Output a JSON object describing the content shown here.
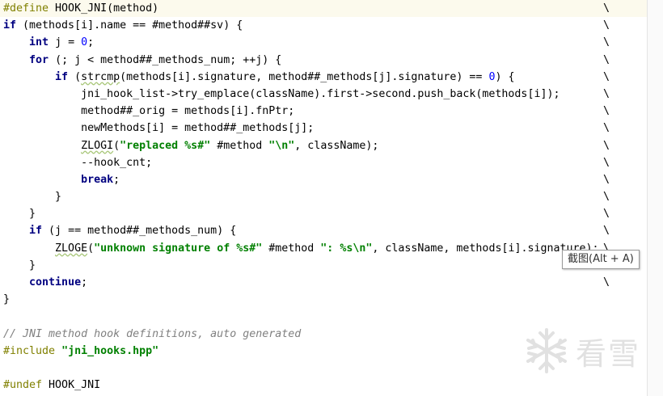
{
  "editor": {
    "lines": [
      {
        "tokens": [
          {
            "t": "#define ",
            "c": "pp"
          },
          {
            "t": "HOOK_JNI(method)",
            "c": "plain"
          }
        ],
        "bs": "\\",
        "current": true
      },
      {
        "tokens": [
          {
            "t": "if",
            "c": "kw"
          },
          {
            "t": " (methods[i].name == #method##sv) {",
            "c": "plain"
          }
        ],
        "bs": "\\"
      },
      {
        "tokens": [
          {
            "t": "    "
          },
          {
            "t": "int",
            "c": "kw"
          },
          {
            "t": " j = ",
            "c": "plain"
          },
          {
            "t": "0",
            "c": "num"
          },
          {
            "t": ";",
            "c": "plain"
          }
        ],
        "bs": "\\"
      },
      {
        "tokens": [
          {
            "t": "    "
          },
          {
            "t": "for",
            "c": "kw"
          },
          {
            "t": " (; j < method##_methods_num; ++j) {",
            "c": "plain"
          }
        ],
        "bs": "\\"
      },
      {
        "tokens": [
          {
            "t": "        "
          },
          {
            "t": "if",
            "c": "kw"
          },
          {
            "t": " (",
            "c": "plain"
          },
          {
            "t": "strcmp",
            "c": "plain",
            "sq": true
          },
          {
            "t": "(methods[i].signature, method##_methods[j].signature) == ",
            "c": "plain"
          },
          {
            "t": "0",
            "c": "num"
          },
          {
            "t": ") {",
            "c": "plain"
          }
        ],
        "bs": "\\"
      },
      {
        "tokens": [
          {
            "t": "            jni_hook_list->try_emplace(className).first->second.push_back(methods[i]);",
            "c": "plain"
          }
        ],
        "bs": "\\"
      },
      {
        "tokens": [
          {
            "t": "            method##_orig = methods[i].fnPtr;",
            "c": "plain"
          }
        ],
        "bs": "\\"
      },
      {
        "tokens": [
          {
            "t": "            newMethods[i] = method##_methods[j];",
            "c": "plain"
          }
        ],
        "bs": "\\"
      },
      {
        "tokens": [
          {
            "t": "            "
          },
          {
            "t": "ZLOGI",
            "c": "plain",
            "sq": true
          },
          {
            "t": "(",
            "c": "plain"
          },
          {
            "t": "\"replaced %s#\"",
            "c": "str"
          },
          {
            "t": " #method ",
            "c": "plain"
          },
          {
            "t": "\"\\n\"",
            "c": "str"
          },
          {
            "t": ", className);",
            "c": "plain"
          }
        ],
        "bs": "\\"
      },
      {
        "tokens": [
          {
            "t": "            --hook_cnt;",
            "c": "plain"
          }
        ],
        "bs": "\\"
      },
      {
        "tokens": [
          {
            "t": "            "
          },
          {
            "t": "break",
            "c": "kw"
          },
          {
            "t": ";",
            "c": "plain"
          }
        ],
        "bs": "\\"
      },
      {
        "tokens": [
          {
            "t": "        }",
            "c": "plain"
          }
        ],
        "bs": "\\"
      },
      {
        "tokens": [
          {
            "t": "    }",
            "c": "plain"
          }
        ],
        "bs": "\\"
      },
      {
        "tokens": [
          {
            "t": "    "
          },
          {
            "t": "if",
            "c": "kw"
          },
          {
            "t": " (j == method##_methods_num) {",
            "c": "plain"
          }
        ],
        "bs": "\\"
      },
      {
        "tokens": [
          {
            "t": "        "
          },
          {
            "t": "ZLOGE",
            "c": "plain",
            "sq": true
          },
          {
            "t": "(",
            "c": "plain"
          },
          {
            "t": "\"unknown signature of %s#\"",
            "c": "str"
          },
          {
            "t": " #method ",
            "c": "plain"
          },
          {
            "t": "\": %s\\n\"",
            "c": "str"
          },
          {
            "t": ", className, methods[i].signature);",
            "c": "plain"
          }
        ],
        "bs": "\\"
      },
      {
        "tokens": [
          {
            "t": "    }",
            "c": "plain"
          }
        ],
        "bs": "\\"
      },
      {
        "tokens": [
          {
            "t": "    "
          },
          {
            "t": "continue",
            "c": "kw"
          },
          {
            "t": ";",
            "c": "plain"
          }
        ],
        "bs": "\\"
      },
      {
        "tokens": [
          {
            "t": "}",
            "c": "plain"
          }
        ],
        "bs": ""
      },
      {
        "tokens": [
          {
            "t": ""
          }
        ],
        "bs": ""
      },
      {
        "tokens": [
          {
            "t": "// JNI method hook definitions, auto generated",
            "c": "cmt"
          }
        ],
        "bs": ""
      },
      {
        "tokens": [
          {
            "t": "#include ",
            "c": "pp"
          },
          {
            "t": "\"jni_hooks.hpp\"",
            "c": "str"
          }
        ],
        "bs": ""
      },
      {
        "tokens": [
          {
            "t": ""
          }
        ],
        "bs": ""
      },
      {
        "tokens": [
          {
            "t": "#undef ",
            "c": "pp"
          },
          {
            "t": "HOOK_JNI",
            "c": "plain"
          }
        ],
        "bs": ""
      }
    ]
  },
  "tooltip": {
    "text": "截图(Alt + A)"
  },
  "watermark": {
    "icon": "snowflake-icon",
    "text": "看雪",
    "color": "#c9c9c9"
  }
}
